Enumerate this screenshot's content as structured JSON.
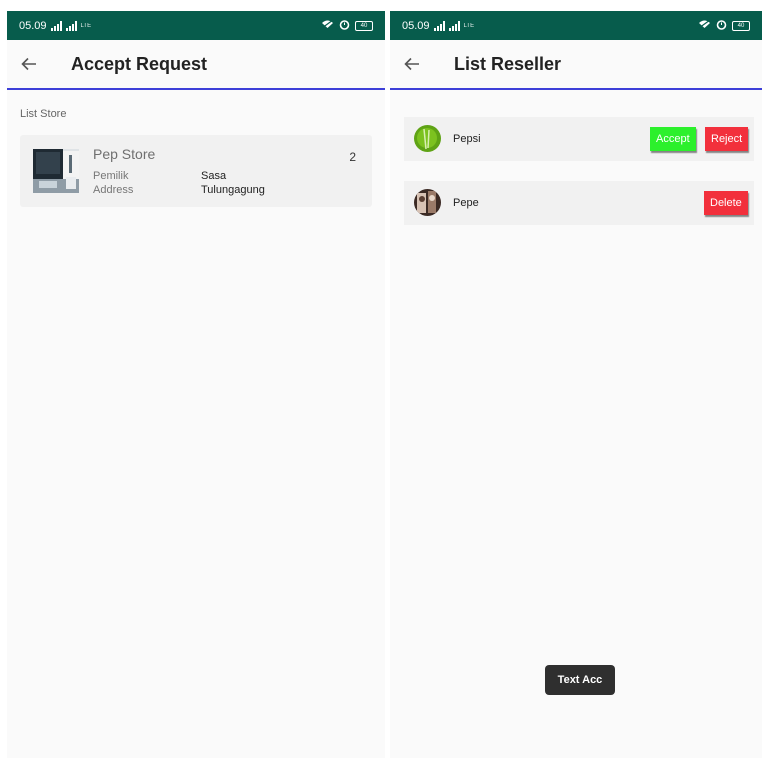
{
  "status_bar": {
    "time": "05.09",
    "network_left": "LTE",
    "network_right": "LTE",
    "battery": "40"
  },
  "left_screen": {
    "title": "Accept Request",
    "section_label": "List Store",
    "store": {
      "name": "Pep Store",
      "count": "2",
      "owner_label": "Pemilik",
      "owner_value": "Sasa",
      "address_label": "Address",
      "address_value": "Tulungagung"
    }
  },
  "right_screen": {
    "title": "List Reseller",
    "resellers": [
      {
        "name": "Pepsi",
        "accept_label": "Accept",
        "reject_label": "Reject"
      },
      {
        "name": "Pepe",
        "delete_label": "Delete"
      }
    ],
    "toast": "Text Acc"
  },
  "colors": {
    "status_bar": "#075c4c",
    "appbar_underline": "#3d3fd8",
    "accept": "#2cf02c",
    "reject": "#f2303c"
  }
}
